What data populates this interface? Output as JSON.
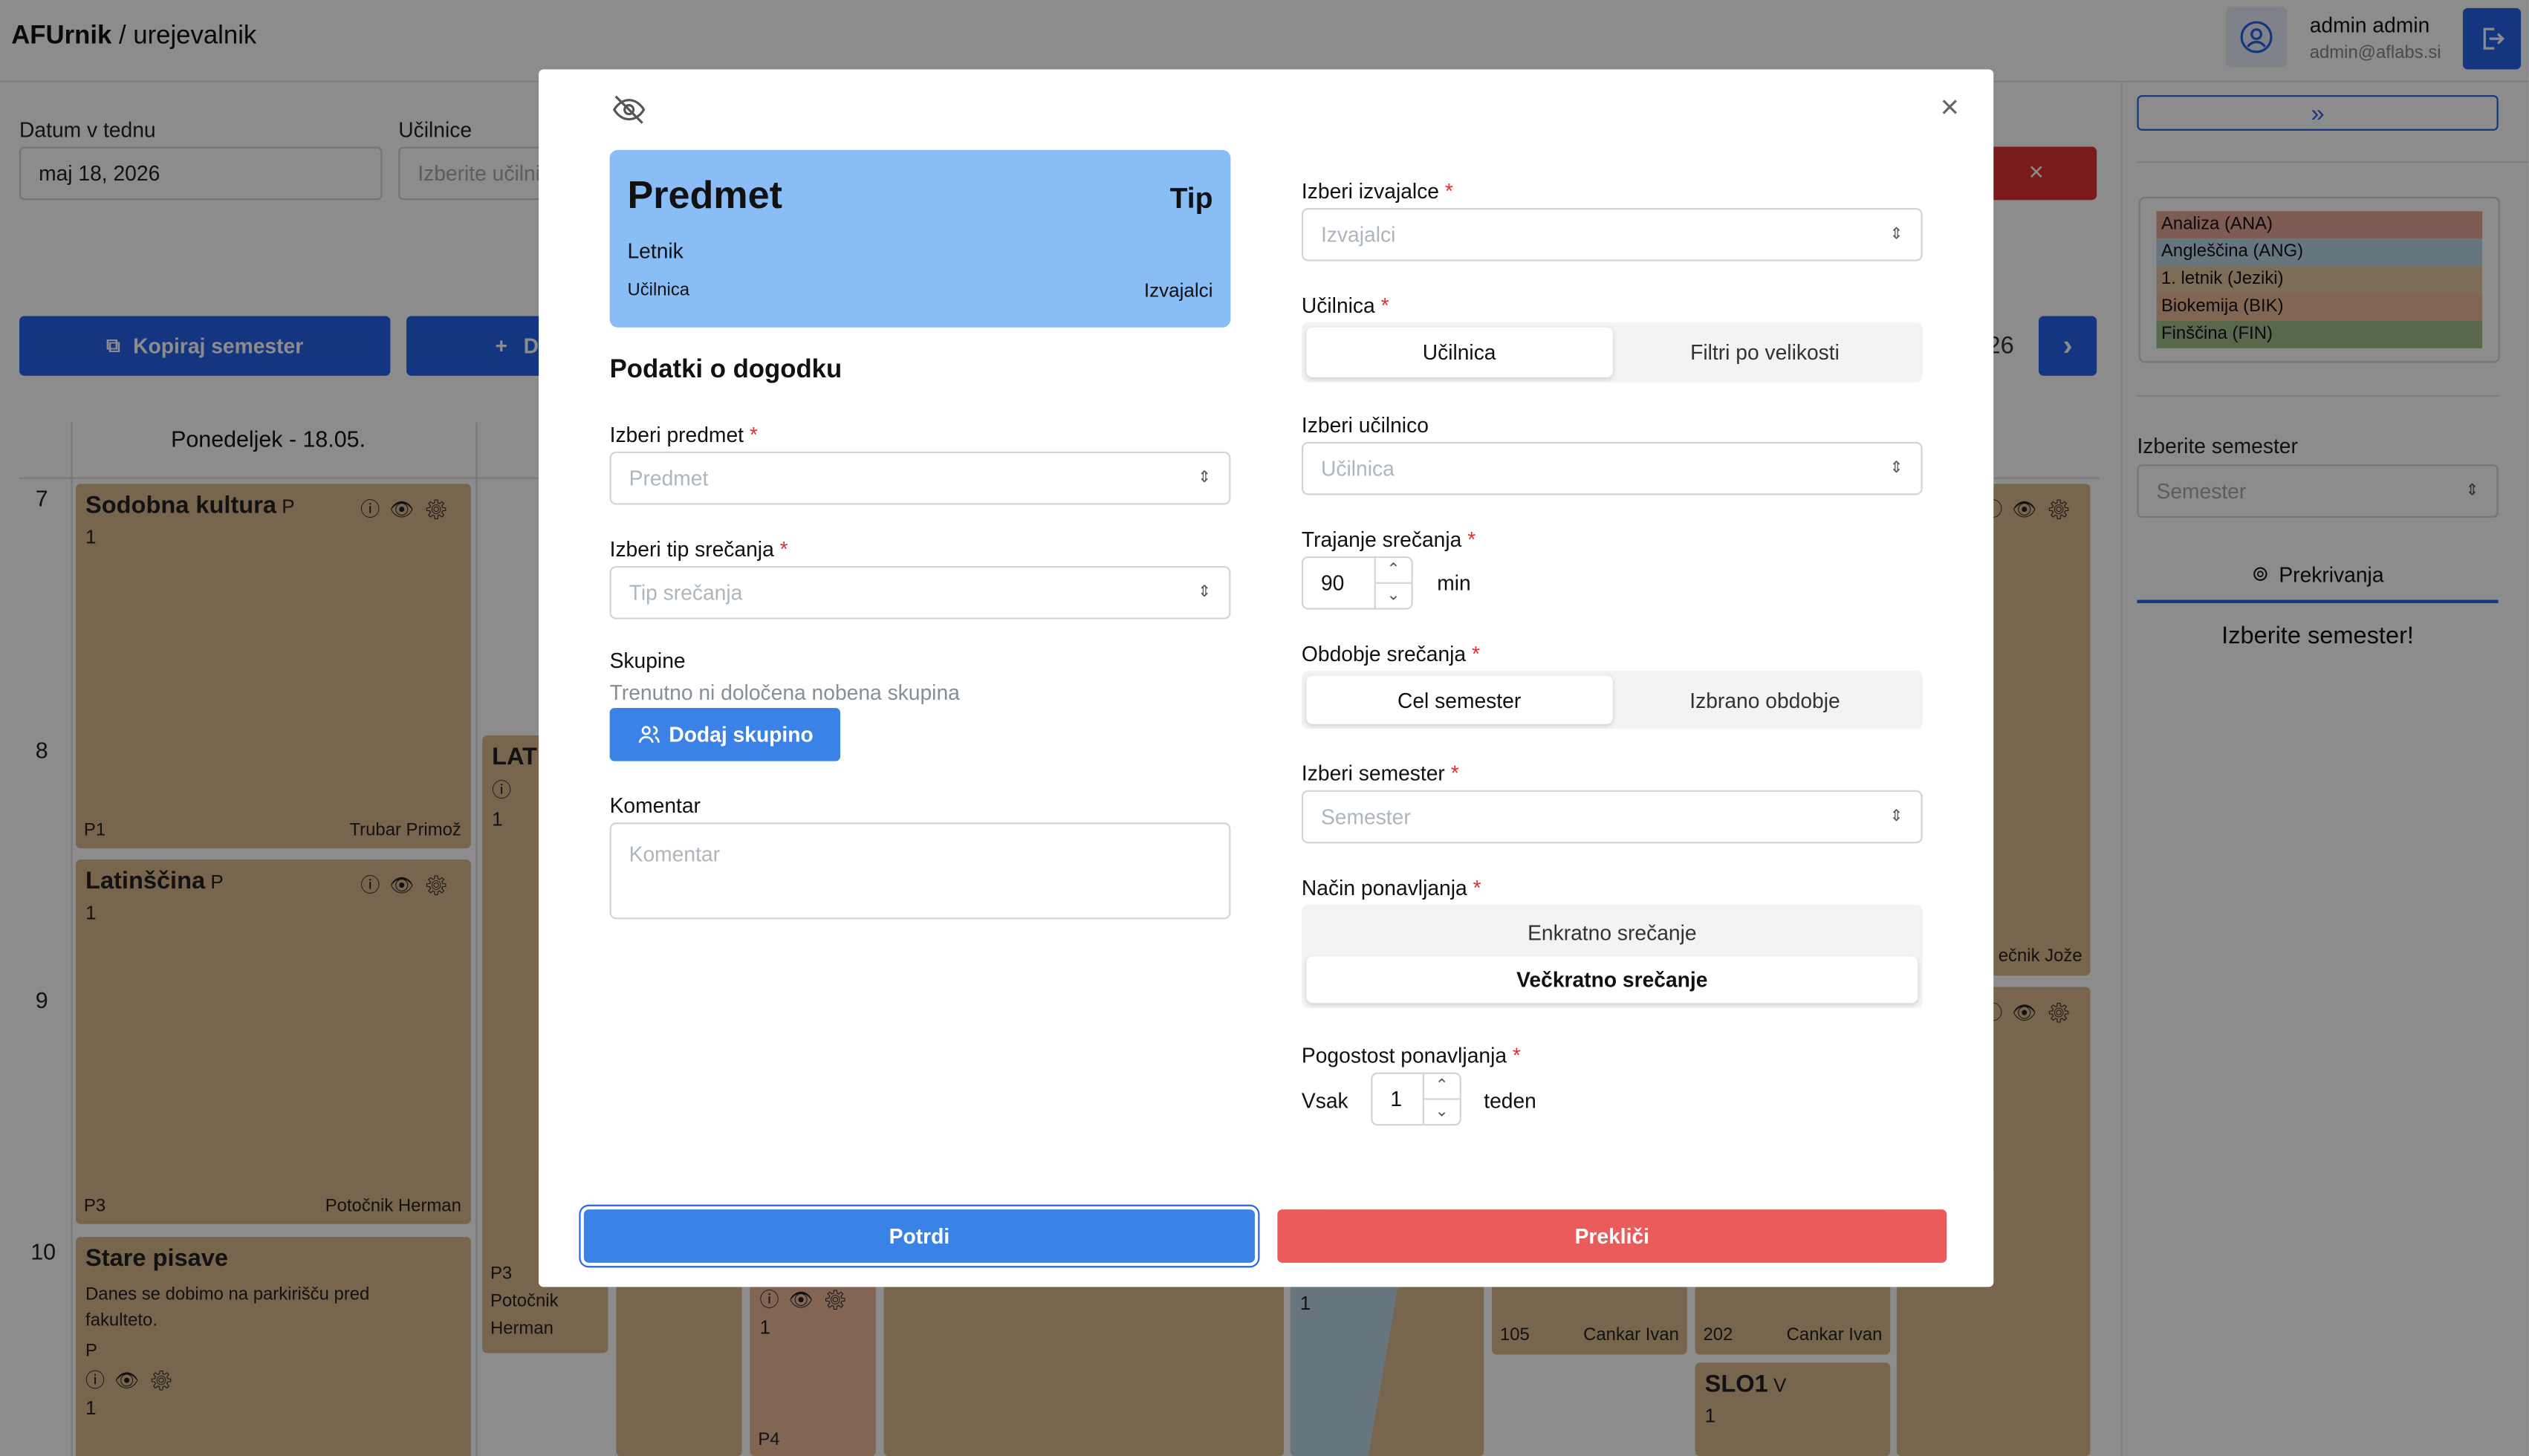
{
  "app": {
    "brand_bold": "AFUrnik",
    "brand_rest": " / urejevalnik",
    "user_name": "admin admin",
    "user_email": "admin@aflabs.si"
  },
  "filters": {
    "date_label": "Datum v tednu",
    "date_value": "maj 18, 2026",
    "room_label": "Učilnice",
    "room_placeholder": "Izberite učilnice",
    "copy_semester": "Kopiraj semester",
    "add_prefix": "+",
    "add_fragment": "D",
    "week_fragment": "26",
    "next_arrow": "›",
    "expand_arrow": "»"
  },
  "calendar": {
    "day_header": "Ponedeljek - 18.05.",
    "hours": [
      "7",
      "8",
      "9",
      "10"
    ],
    "events": {
      "e1": {
        "title": "Sodobna kultura",
        "type": "P",
        "group": "1",
        "room": "P1",
        "teacher": "Trubar Primož"
      },
      "e2": {
        "title": "Latinščina",
        "type": "P",
        "group": "1",
        "room": "P3",
        "teacher": "Potočnik Herman"
      },
      "e3": {
        "title": "Stare pisave",
        "note": "Danes se dobimo na parkirišču pred fakulteto.",
        "type": "P",
        "group": "1"
      },
      "e4": {
        "title": "LAT",
        "group": "1",
        "room": "P3",
        "teacher_line1": "Potočnik",
        "teacher_line2": "Herman"
      },
      "e5": {
        "teacher_fragment": "ečnik Jože"
      },
      "e6": {
        "group": "1",
        "room": "P4"
      },
      "e7": {
        "group": "1"
      },
      "e8": {
        "room": "105",
        "teacher": "Cankar Ivan"
      },
      "e9": {
        "room": "202",
        "teacher": "Cankar Ivan"
      },
      "e10": {
        "title": "SLO1",
        "type": "V",
        "group": "1"
      }
    }
  },
  "sidebar": {
    "legend": [
      "Analiza (ANA)",
      "Angleščina (ANG)",
      "1. letnik (Jeziki)",
      "Biokemija (BIK)",
      "Finščina (FIN)"
    ],
    "legend_colors": [
      "#e8a898",
      "#bcd6e6",
      "#e3c7a0",
      "#efb89a",
      "#9fbd8a"
    ],
    "semester_label": "Izberite semester",
    "semester_placeholder": "Semester",
    "overlaps_tab": "Prekrivanja",
    "semester_prompt": "Izberite semester!"
  },
  "modal": {
    "preview": {
      "subject": "Predmet",
      "type": "Tip",
      "year": "Letnik",
      "room": "Učilnica",
      "teachers": "Izvajalci",
      "color": "#88bdf6"
    },
    "section_title": "Podatki o dogodku",
    "subject_label": "Izberi predmet",
    "subject_placeholder": "Predmet",
    "meeting_type_label": "Izberi tip srečanja",
    "meeting_type_placeholder": "Tip srečanja",
    "groups_label": "Skupine",
    "groups_empty": "Trenutno ni določena nobena skupina",
    "add_group": "Dodaj skupino",
    "comment_label": "Komentar",
    "comment_placeholder": "Komentar",
    "teachers_label": "Izberi izvajalce",
    "teachers_placeholder": "Izvajalci",
    "room_label": "Učilnica",
    "room_tabs": [
      "Učilnica",
      "Filtri po velikosti"
    ],
    "room_select_label": "Izberi učilnico",
    "room_select_placeholder": "Učilnica",
    "duration_label": "Trajanje srečanja",
    "duration_value": "90",
    "duration_unit": "min",
    "period_label": "Obdobje srečanja",
    "period_tabs": [
      "Cel semester",
      "Izbrano obdobje"
    ],
    "semester_label": "Izberi semester",
    "semester_placeholder": "Semester",
    "repeat_label": "Način ponavljanja",
    "repeat_options": [
      "Enkratno srečanje",
      "Večkratno srečanje"
    ],
    "freq_label": "Pogostost ponavljanja",
    "freq_prefix": "Vsak",
    "freq_value": "1",
    "freq_unit": "teden",
    "confirm": "Potrdi",
    "cancel": "Prekliči",
    "close": "×",
    "required_mark": "*"
  }
}
